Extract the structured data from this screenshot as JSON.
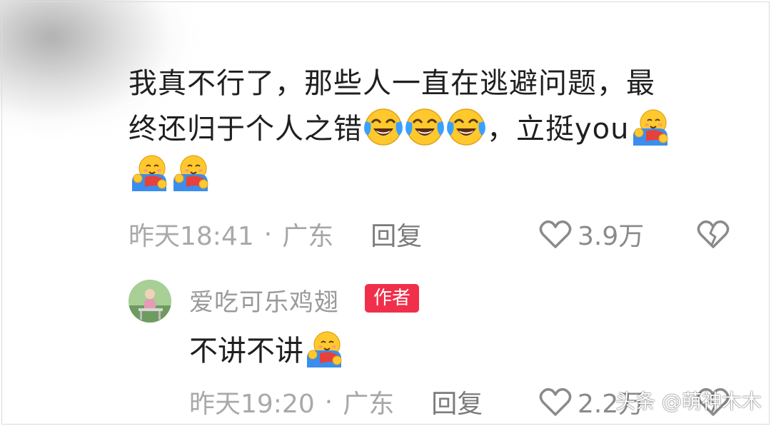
{
  "comment": {
    "line1": "我真不行了，那些人一直在逃避问题，最",
    "line2_text": "终还归于个人之错",
    "line2_suffix": "，立挺you",
    "emojis_laugh_cry": 3,
    "emojis_hug": 3,
    "meta": {
      "time": "昨天18:41",
      "separator": "·",
      "location": "广东",
      "reply_label": "回复",
      "like_count": "3.9万"
    }
  },
  "reply": {
    "username": "爱吃可乐鸡翅",
    "badge": "作者",
    "text": "不讲不讲",
    "meta": {
      "time": "昨天19:20",
      "separator": "·",
      "location": "广东",
      "reply_label": "回复",
      "like_count": "2.2万"
    }
  },
  "watermark": "头条 @萌神木木",
  "icons": {
    "like": "heart-outline-icon",
    "dislike": "broken-heart-icon",
    "emoji_a": "laugh-cry-emoji",
    "emoji_b": "hug-emoji"
  },
  "colors": {
    "badge": "#f0304a",
    "text": "#1f1f1f",
    "meta": "#a6a6a6"
  }
}
